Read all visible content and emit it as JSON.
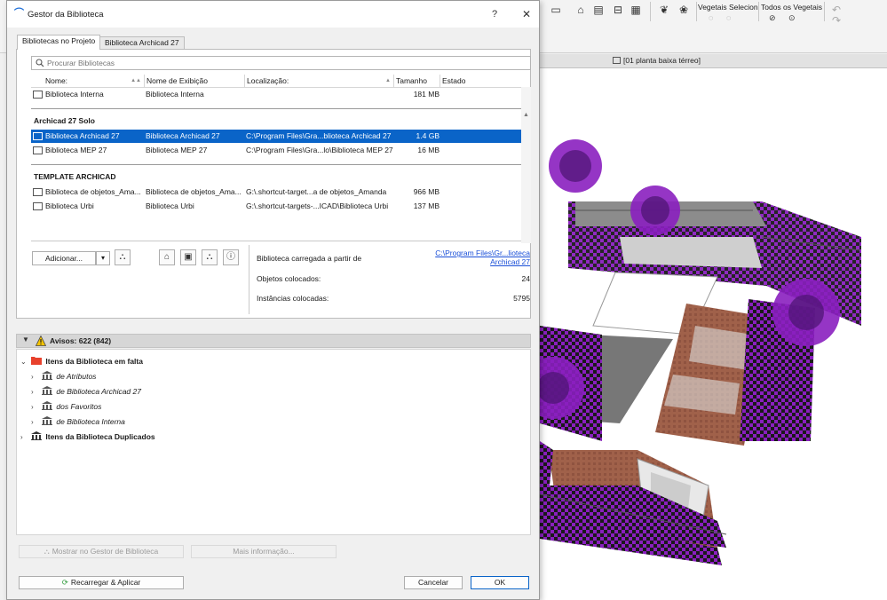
{
  "dialog": {
    "title": "Gestor da Biblioteca",
    "help_label": "?",
    "close_label": "✕",
    "tabs": [
      {
        "label": "Bibliotecas no Projeto",
        "active": true
      },
      {
        "label": "Biblioteca Archicad 27",
        "active": false
      }
    ],
    "search": {
      "placeholder": "Procurar Bibliotecas",
      "value": ""
    },
    "table": {
      "columns": [
        "Nome:",
        "Nome de Exibição",
        "Localização:",
        "Tamanho",
        "Estado"
      ],
      "rows_top": [
        {
          "name": "Biblioteca Interna",
          "display": "Biblioteca Interna",
          "location": "",
          "size": "181 MB",
          "selected": false
        }
      ],
      "groups": [
        {
          "title": "Archicad 27 Solo",
          "rows": [
            {
              "name": "Biblioteca Archicad 27",
              "display": "Biblioteca Archicad 27",
              "location": "C:\\Program Files\\Gra...blioteca Archicad 27",
              "size": "1.4 GB",
              "selected": true
            },
            {
              "name": "Biblioteca MEP 27",
              "display": "Biblioteca MEP 27",
              "location": "C:\\Program Files\\Gra...lo\\Biblioteca MEP 27",
              "size": "16 MB",
              "selected": false
            }
          ]
        },
        {
          "title": "TEMPLATE ARCHICAD",
          "rows": [
            {
              "name": "Biblioteca de objetos_Ama...",
              "display": "Biblioteca de objetos_Ama...",
              "location": "G:\\.shortcut-target...a de objetos_Amanda",
              "size": "966 MB",
              "selected": false
            },
            {
              "name": "Biblioteca Urbi",
              "display": "Biblioteca Urbi",
              "location": "G:\\.shortcut-targets-...ICAD\\Biblioteca Urbi",
              "size": "137 MB",
              "selected": false
            }
          ]
        }
      ]
    },
    "add_button": "Adicionar...",
    "add_dropdown": "▾",
    "info": {
      "loaded_label": "Biblioteca carregada a partir de",
      "loaded_link": "C:\\Program Files\\Gr...lioteca Archicad 27",
      "objects_label": "Objetos colocados:",
      "objects_value": "24",
      "instances_label": "Instâncias colocadas:",
      "instances_value": "5795"
    },
    "warnings": {
      "title": "Avisos: 622 (842)",
      "tree": [
        {
          "label": "Itens da Biblioteca em falta",
          "level": 0,
          "bold": true,
          "italic": false,
          "expanded": true
        },
        {
          "label": "de Atributos",
          "level": 1,
          "bold": false,
          "italic": true,
          "expanded": false
        },
        {
          "label": "de Biblioteca Archicad 27",
          "level": 1,
          "bold": false,
          "italic": true,
          "expanded": false
        },
        {
          "label": "dos Favoritos",
          "level": 1,
          "bold": false,
          "italic": true,
          "expanded": false
        },
        {
          "label": "de Biblioteca Interna",
          "level": 1,
          "bold": false,
          "italic": true,
          "expanded": false
        },
        {
          "label": "Itens da Biblioteca Duplicados",
          "level": 0,
          "bold": true,
          "italic": false,
          "expanded": false
        }
      ]
    },
    "show_in_manager": "Mostrar no Gestor de Biblioteca",
    "more_info": "Mais informação...",
    "reload_apply": "Recarregar & Aplicar",
    "cancel": "Cancelar",
    "ok": "OK"
  },
  "app": {
    "toolbar_labels": [
      "Vegetais Selecion",
      "Todos os Vegetais"
    ],
    "view_tab": "[01 planta baixa térreo]"
  },
  "colors": {
    "selection": "#0a64c8",
    "link": "#1a4fd8",
    "warning": "#f5c400",
    "missing_folder": "#e8412c",
    "vegetation": "#8a1fbf"
  }
}
